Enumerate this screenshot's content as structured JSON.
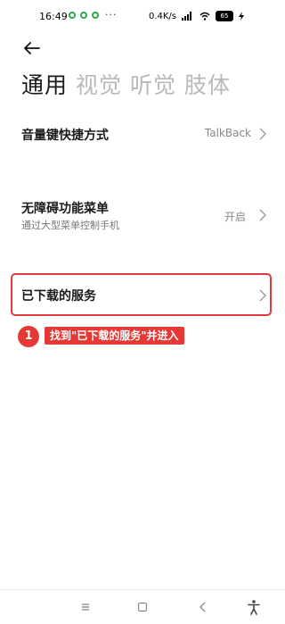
{
  "status_bar": {
    "time": "16:49",
    "network_speed": "0.4K/s",
    "battery": "65"
  },
  "tabs": [
    {
      "label": "通用",
      "active": true
    },
    {
      "label": "视觉",
      "active": false
    },
    {
      "label": "听觉",
      "active": false
    },
    {
      "label": "肢体",
      "active": false
    }
  ],
  "settings": {
    "volume_shortcut": {
      "title": "音量键快捷方式",
      "value": "TalkBack"
    },
    "a11y_menu": {
      "title": "无障碍功能菜单",
      "subtitle": "通过大型菜单控制手机",
      "value": "开启"
    },
    "downloaded_services": {
      "title": "已下载的服务"
    }
  },
  "annotation": {
    "step_number": "1",
    "text": "找到\"已下载的服务\"并进入"
  },
  "colors": {
    "highlight": "#e23b3b",
    "badge": "#e53935",
    "notification_icon": "#2ca84e"
  }
}
